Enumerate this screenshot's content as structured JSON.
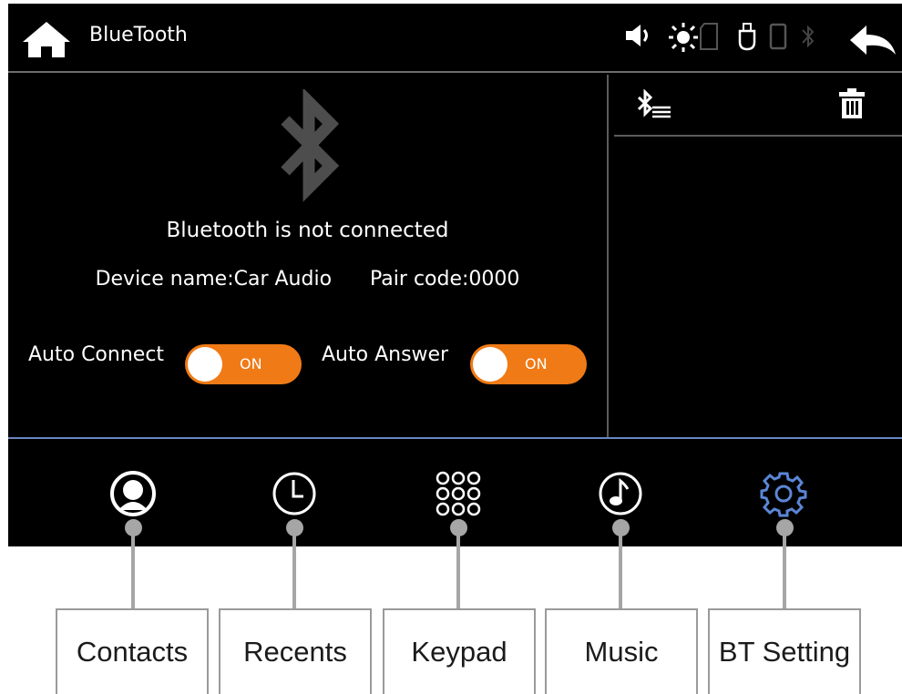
{
  "topbar": {
    "title": "BlueTooth"
  },
  "main": {
    "status_text": "Bluetooth is not connected",
    "device_label": "Device name:Car Audio",
    "pair_label": "Pair code:0000",
    "auto_connect": {
      "label": "Auto Connect",
      "state": "ON"
    },
    "auto_answer": {
      "label": "Auto Answer",
      "state": "ON"
    }
  },
  "nav": {
    "items": [
      {
        "icon": "contacts-icon",
        "label": "Contacts"
      },
      {
        "icon": "recents-icon",
        "label": "Recents"
      },
      {
        "icon": "keypad-icon",
        "label": "Keypad"
      },
      {
        "icon": "music-icon",
        "label": "Music"
      },
      {
        "icon": "gear-icon",
        "label": "BT Setting"
      }
    ]
  },
  "colors": {
    "accent": "#f07a16",
    "active_icon": "#5b86d6",
    "divider": "#6b87bd"
  }
}
